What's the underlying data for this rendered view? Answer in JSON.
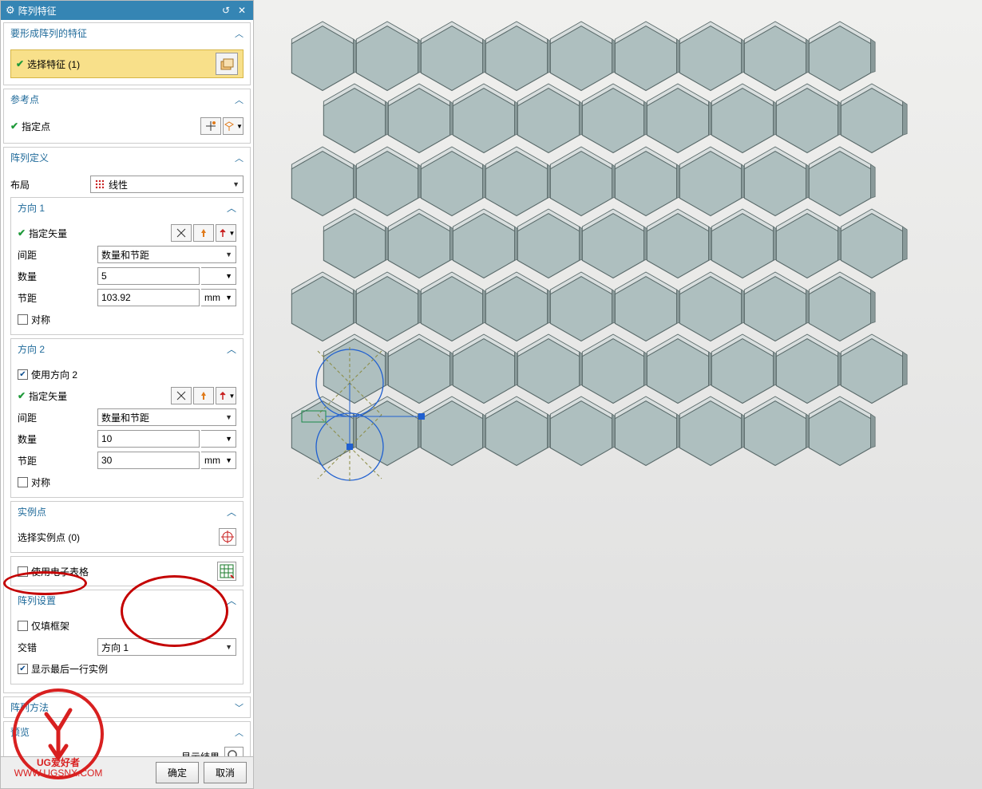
{
  "dialog": {
    "title": "阵列特征",
    "features_section": "要形成阵列的特征",
    "select_feature": "选择特征 (1)",
    "ref_point_section": "参考点",
    "specify_point": "指定点",
    "pattern_def_section": "阵列定义",
    "layout_label": "布局",
    "layout_value": "线性",
    "dir1": {
      "title": "方向 1",
      "specify_vector": "指定矢量",
      "spacing_label": "间距",
      "spacing_value": "数量和节距",
      "count_label": "数量",
      "count_value": "5",
      "pitch_label": "节距",
      "pitch_value": "103.92",
      "pitch_unit": "mm",
      "symmetric": "对称"
    },
    "dir2": {
      "title": "方向 2",
      "use_dir2": "使用方向 2",
      "specify_vector": "指定矢量",
      "spacing_label": "间距",
      "spacing_value": "数量和节距",
      "count_label": "数量",
      "count_value": "10",
      "pitch_label": "节距",
      "pitch_value": "30",
      "pitch_unit": "mm",
      "symmetric": "对称"
    },
    "instance_points": {
      "title": "实例点",
      "select": "选择实例点 (0)"
    },
    "use_spreadsheet": "使用电子表格",
    "pattern_settings": {
      "title": "阵列设置",
      "frame_only": "仅填框架",
      "stagger_label": "交错",
      "stagger_value": "方向 1",
      "show_last_row": "显示最后一行实例"
    },
    "pattern_method": "阵列方法",
    "preview": "预览",
    "show_result": "显示结果",
    "ok": "确定",
    "cancel": "取消"
  },
  "watermark": {
    "line1": "UG爱好者",
    "line2": "WWW.UGSNX.COM"
  },
  "icons": {
    "gear": "gear-icon",
    "reset": "reset-icon",
    "close": "close-icon",
    "chevron_up": "chevron-up-icon",
    "feature_block": "feature-block-icon",
    "point_plus": "point-plus-icon",
    "point_minus": "point-minus-icon",
    "linear_grid": "linear-grid-icon",
    "vector_pick": "vector-pick-icon",
    "vector_reverse": "vector-reverse-icon",
    "vector_axis": "vector-axis-icon",
    "target": "target-icon",
    "spreadsheet": "spreadsheet-icon",
    "magnifier": "magnifier-icon"
  }
}
